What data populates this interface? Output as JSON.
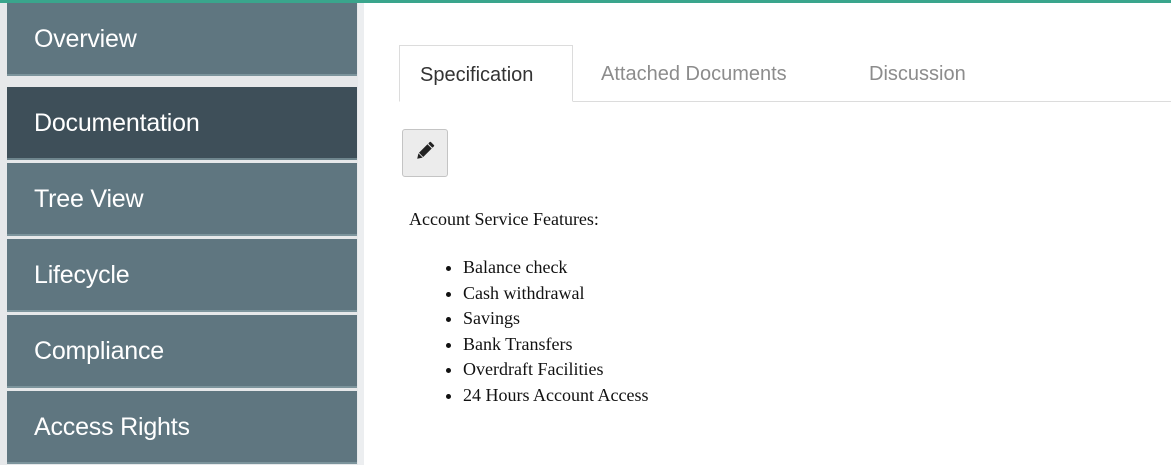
{
  "sidebar": {
    "items": [
      {
        "label": "Overview"
      },
      {
        "label": "Documentation"
      },
      {
        "label": "Tree View"
      },
      {
        "label": "Lifecycle"
      },
      {
        "label": "Compliance"
      },
      {
        "label": "Access Rights"
      }
    ],
    "active_label": "Documentation"
  },
  "main": {
    "tabs": [
      {
        "label": "Specification"
      },
      {
        "label": "Attached Documents"
      },
      {
        "label": "Discussion"
      }
    ],
    "active_tab": "Specification",
    "edit_button": {
      "icon": "pencil-icon"
    },
    "content": {
      "heading": "Account Service Features:",
      "features": [
        "Balance check",
        "Cash withdrawal",
        "Savings",
        "Bank Transfers",
        "Overdraft Facilities",
        "24 Hours Account Access"
      ]
    }
  },
  "colors": {
    "sidebar_item": "#5f7680",
    "sidebar_item_active": "#3e4f59",
    "accent_line": "#3aa58c"
  }
}
